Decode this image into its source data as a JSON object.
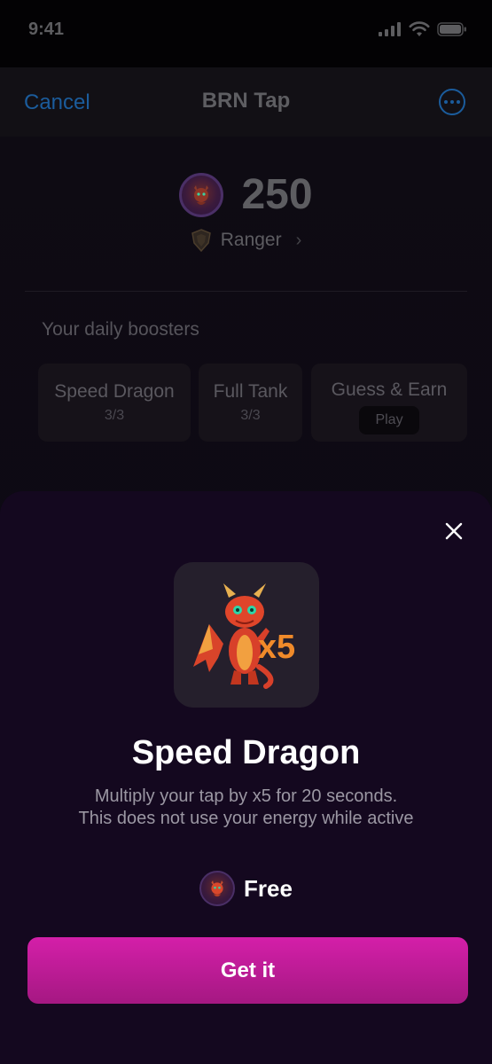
{
  "status_bar": {
    "time": "9:41"
  },
  "nav": {
    "cancel_label": "Cancel",
    "title": "BRN Tap",
    "more_icon": "more-circle-icon"
  },
  "balance": {
    "value": "250",
    "coin_icon": "dragon-coin-icon"
  },
  "rank": {
    "label": "Ranger",
    "icon": "shield-badge-icon"
  },
  "boosters": {
    "heading": "Your daily boosters",
    "items": [
      {
        "name": "Speed Dragon",
        "count": "3/3"
      },
      {
        "name": "Full Tank",
        "count": "3/3"
      },
      {
        "name": "Guess & Earn",
        "action": "Play"
      }
    ]
  },
  "sheet": {
    "image_badge": "x5",
    "title": "Speed Dragon",
    "description_line1": "Multiply your tap by x5 for 20 seconds.",
    "description_line2": "This does not use your energy while active",
    "price": "Free",
    "cta_label": "Get it"
  },
  "colors": {
    "accent_link": "#1b5c9c",
    "cta_top": "#d41fa9",
    "cta_bottom": "#a51882",
    "sheet_bg": "#14081f"
  }
}
